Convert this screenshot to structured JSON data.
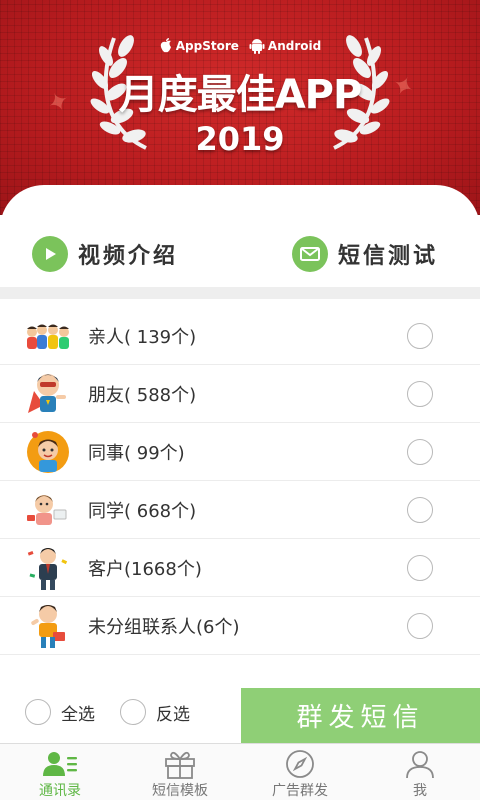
{
  "banner": {
    "store_apple": "AppStore",
    "store_android": "Android",
    "award_title": "月度最佳APP",
    "award_year": "2019"
  },
  "quick_actions": {
    "video_label": "视频介绍",
    "sms_label": "短信测试"
  },
  "groups": [
    {
      "label": "亲人( 139个)",
      "icon": "family-illustration"
    },
    {
      "label": "朋友( 588个)",
      "icon": "friend-superhero-illustration"
    },
    {
      "label": "同事(  99个)",
      "icon": "colleague-illustration"
    },
    {
      "label": "同学( 668个)",
      "icon": "classmate-illustration"
    },
    {
      "label": "客户(1668个)",
      "icon": "client-illustration"
    },
    {
      "label": "未分组联系人(6个)",
      "icon": "ungrouped-illustration"
    }
  ],
  "selection": {
    "select_all_label": "全选",
    "invert_label": "反选"
  },
  "send_button_label": "群发短信",
  "tabs": [
    {
      "label": "通讯录",
      "icon": "contacts-icon",
      "active": true
    },
    {
      "label": "短信模板",
      "icon": "gift-icon",
      "active": false
    },
    {
      "label": "广告群发",
      "icon": "compass-icon",
      "active": false
    },
    {
      "label": "我",
      "icon": "user-icon",
      "active": false
    }
  ],
  "colors": {
    "banner_red": "#b81c1f",
    "accent_green": "#7bc35b",
    "send_button": "#8fcf76",
    "active_tab": "#5fb745"
  }
}
